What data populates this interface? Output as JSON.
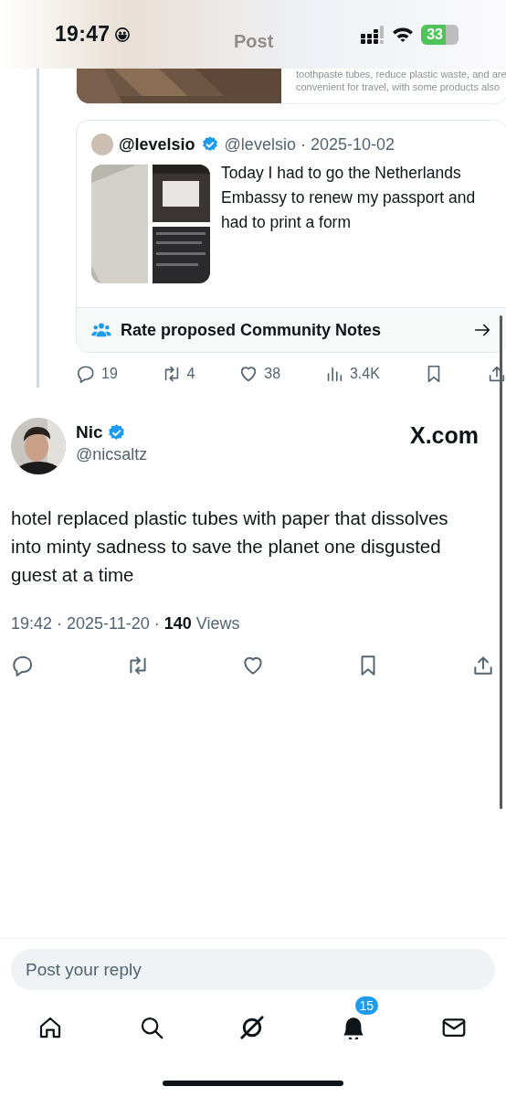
{
  "status_bar": {
    "time": "19:47",
    "battery": "33"
  },
  "header": {
    "title": "Post"
  },
  "previous_card": {
    "lines": [
      "toothpaste tubes, reduce plastic waste, and are",
      "convenient for travel, with some products also"
    ]
  },
  "quoted_post": {
    "name": "@levelsio",
    "verified": true,
    "handle_date": "@levelsio · 2025-10-02",
    "text": "Today I had to go the Netherlands Embassy to renew my passport and had to print a form",
    "notes_prompt": "Rate proposed Community Notes"
  },
  "quoted_actions": [
    {
      "kind": "reply",
      "count": "19"
    },
    {
      "kind": "repost",
      "count": "4"
    },
    {
      "kind": "like",
      "count": "38"
    },
    {
      "kind": "views",
      "count": "3.4K"
    },
    {
      "kind": "bookmark"
    },
    {
      "kind": "share"
    }
  ],
  "post": {
    "name": "Nic",
    "verified": true,
    "handle": "@nicsaltz",
    "source": "X.com",
    "text": "hotel replaced plastic tubes with paper that dissolves into minty sadness to save the planet one disgusted guest at a time",
    "meta": "19:42 · 2025-11-20 · **140** Views"
  },
  "post_actions": [
    {
      "kind": "reply"
    },
    {
      "kind": "repost"
    },
    {
      "kind": "like"
    },
    {
      "kind": "bookmark"
    },
    {
      "kind": "share"
    }
  ],
  "reply": {
    "placeholder": "Post your reply"
  },
  "nav": [
    {
      "kind": "home"
    },
    {
      "kind": "search"
    },
    {
      "kind": "grok"
    },
    {
      "kind": "notifications",
      "badge": "15"
    },
    {
      "kind": "messages"
    }
  ]
}
